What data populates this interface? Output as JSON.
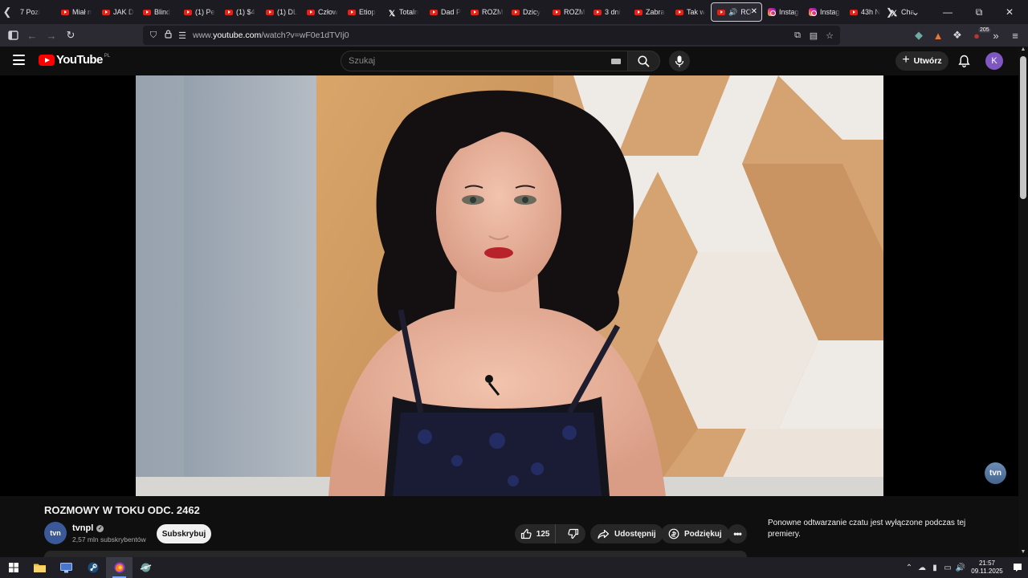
{
  "browser": {
    "tabs": [
      {
        "label": "7 Pozi",
        "icon": "none"
      },
      {
        "label": "Miał n",
        "icon": "youtube"
      },
      {
        "label": "JAK D",
        "icon": "youtube"
      },
      {
        "label": "Blind",
        "icon": "youtube"
      },
      {
        "label": "(1) Pe",
        "icon": "youtube"
      },
      {
        "label": "(1) $4",
        "icon": "youtube"
      },
      {
        "label": "(1) DL",
        "icon": "youtube"
      },
      {
        "label": "Człow",
        "icon": "youtube"
      },
      {
        "label": "Etiop",
        "icon": "youtube"
      },
      {
        "label": "Totaln",
        "icon": "x"
      },
      {
        "label": "Dad P",
        "icon": "youtube"
      },
      {
        "label": "ROZM",
        "icon": "youtube"
      },
      {
        "label": "Dzicy",
        "icon": "youtube"
      },
      {
        "label": "ROZM",
        "icon": "youtube"
      },
      {
        "label": "3 dni",
        "icon": "youtube"
      },
      {
        "label": "Zabra",
        "icon": "youtube"
      },
      {
        "label": "Tak w",
        "icon": "youtube"
      },
      {
        "label": "RO",
        "icon": "youtube",
        "active": true
      },
      {
        "label": "Instag",
        "icon": "instagram"
      },
      {
        "label": "Instag",
        "icon": "instagram"
      },
      {
        "label": "43h N",
        "icon": "youtube"
      },
      {
        "label": "Cha",
        "icon": "x"
      }
    ],
    "url_prefix": "www.",
    "url_host": "youtube.com",
    "url_path": "/watch?v=wF0e1dTVIj0",
    "extension_badge": "205"
  },
  "youtube": {
    "logo_text": "YouTube",
    "country_code": "PL",
    "search_placeholder": "Szukaj",
    "create_label": "Utwórz",
    "avatar_letter": "K"
  },
  "video": {
    "watermark": "tvn",
    "title": "ROZMOWY W TOKU ODC. 2462",
    "channel_name": "tvnpl",
    "channel_avatar_text": "tvn",
    "subscribers": "2,57 mln subskrybentów",
    "subscribe_label": "Subskrybuj",
    "likes": "125",
    "share_label": "Udostępnij",
    "thanks_label": "Podziękuj",
    "more_label": "•••"
  },
  "chat": {
    "note": "Ponowne odtwarzanie czatu jest wyłączone podczas tej premiery."
  },
  "taskbar": {
    "time": "21:57",
    "date": "09.11.2025"
  }
}
